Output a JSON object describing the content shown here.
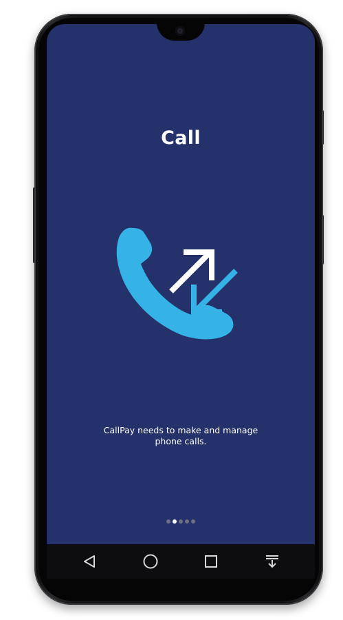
{
  "onboarding": {
    "title": "Call",
    "description_line1": "CallPay needs to make and manage",
    "description_line2": "phone calls.",
    "illustration_icon": "phone-incoming-outgoing-icon",
    "pager": {
      "total": 5,
      "current": 2
    }
  },
  "navbar": {
    "back_icon": "back-triangle-icon",
    "home_icon": "home-circle-icon",
    "recents_icon": "recents-square-icon",
    "notifications_icon": "pull-down-notifications-icon"
  },
  "colors": {
    "screen_bg": "#24316b",
    "accent_blue": "#36b3e6",
    "text": "#ffffff",
    "dot_inactive": "#6d6f85",
    "navbar_bg": "#0d0d0f"
  }
}
